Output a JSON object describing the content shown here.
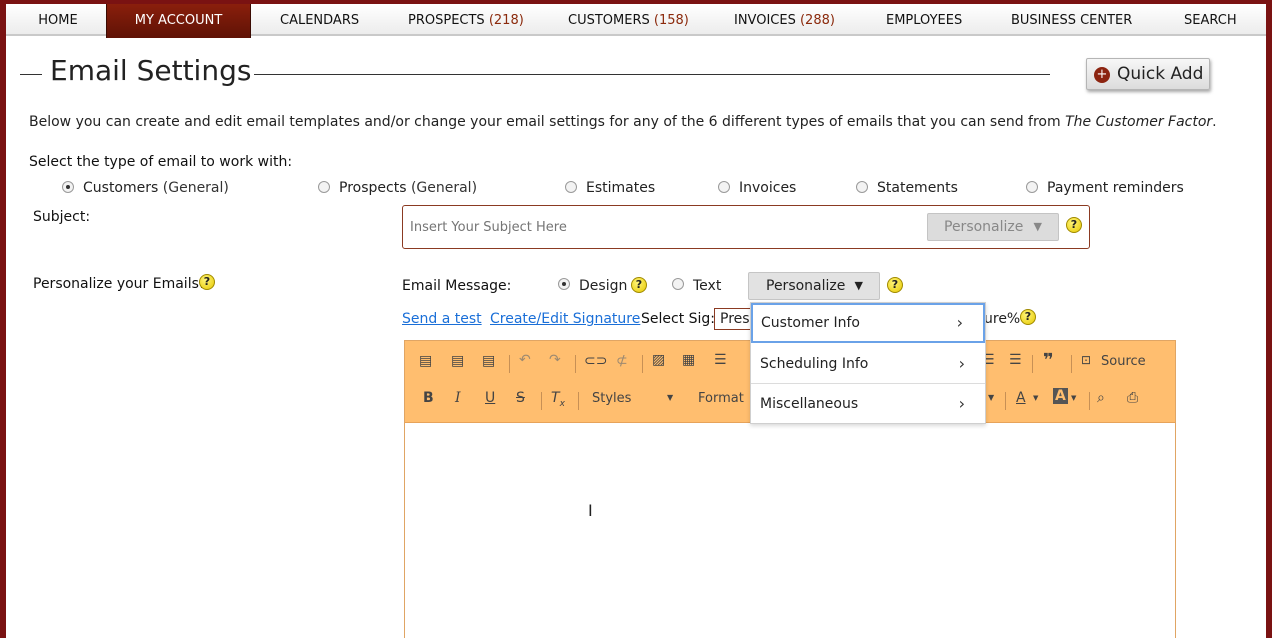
{
  "nav": [
    {
      "label": "HOME",
      "count": ""
    },
    {
      "label": "MY ACCOUNT",
      "count": ""
    },
    {
      "label": "CALENDARS",
      "count": ""
    },
    {
      "label": "PROSPECTS",
      "count": "(218)"
    },
    {
      "label": "CUSTOMERS",
      "count": "(158)"
    },
    {
      "label": "INVOICES",
      "count": "(288)"
    },
    {
      "label": "EMPLOYEES",
      "count": ""
    },
    {
      "label": "BUSINESS CENTER",
      "count": ""
    },
    {
      "label": "SEARCH",
      "count": ""
    }
  ],
  "header": {
    "title": "Email Settings",
    "quick_add": "Quick Add"
  },
  "intro": {
    "text": "Below you can create and edit email templates and/or change your email settings for any of the 6 different types of emails that you can send from ",
    "brand": "The Customer Factor",
    "end": "."
  },
  "email_types": {
    "label": "Select the type of email to work with:",
    "options": [
      {
        "label": "Customers",
        "paren": "(General)",
        "selected": true
      },
      {
        "label": "Prospects",
        "paren": "(General)",
        "selected": false
      },
      {
        "label": "Estimates",
        "paren": "",
        "selected": false
      },
      {
        "label": "Invoices",
        "paren": "",
        "selected": false
      },
      {
        "label": "Statements",
        "paren": "",
        "selected": false
      },
      {
        "label": "Payment reminders",
        "paren": "",
        "selected": false
      }
    ]
  },
  "subject": {
    "label": "Subject:",
    "placeholder": "Insert Your Subject Here",
    "personalize": "Personalize",
    "arrow": "▼"
  },
  "personalize_emails": "Personalize your Emails!",
  "message": {
    "label": "Email Message:",
    "mode_design": "Design",
    "mode_text": "Text",
    "selected_mode": "Design",
    "personalize": "Personalize",
    "arrow": "▼"
  },
  "links": {
    "send_test": "Send a test",
    "edit_signature": "Create/Edit Signature"
  },
  "signature": {
    "label": "Select Sig:",
    "value": "Press",
    "suffix": "ure%"
  },
  "toolbar": {
    "source": "Source",
    "styles": "Styles",
    "format": "Format"
  },
  "dropdown": {
    "items": [
      "Customer Info",
      "Scheduling Info",
      "Miscellaneous"
    ]
  },
  "help_mark": "?"
}
